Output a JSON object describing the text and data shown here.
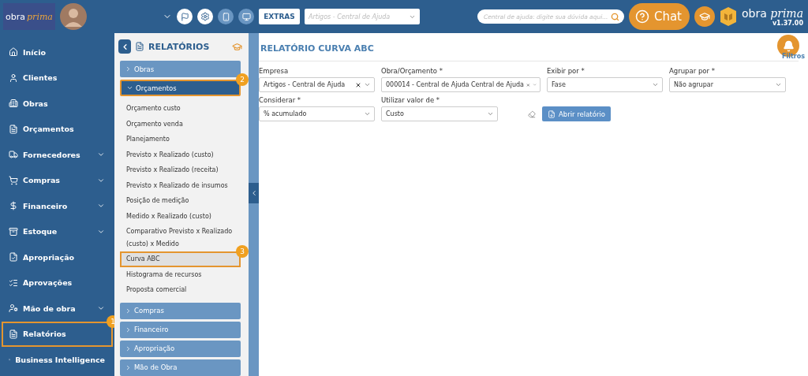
{
  "header": {
    "logo": {
      "word1": "obra",
      "word2": "prima"
    },
    "extras": "EXTRAS",
    "article_select": {
      "placeholder": "Artigos - Central de Ajuda"
    },
    "help_search": {
      "placeholder": "Central de ajuda: digite sua dúvida aqui..."
    },
    "chat": "Chat",
    "brand": {
      "word1": "obra",
      "word2": "prima"
    },
    "version": "v1.37.00"
  },
  "sidebar": {
    "items": [
      {
        "label": "Início",
        "expandable": false,
        "selected": false
      },
      {
        "label": "Clientes",
        "expandable": false,
        "selected": false
      },
      {
        "label": "Obras",
        "expandable": false,
        "selected": false
      },
      {
        "label": "Orçamentos",
        "expandable": false,
        "selected": false
      },
      {
        "label": "Fornecedores",
        "expandable": true,
        "selected": false
      },
      {
        "label": "Compras",
        "expandable": true,
        "selected": false
      },
      {
        "label": "Financeiro",
        "expandable": true,
        "selected": false
      },
      {
        "label": "Estoque",
        "expandable": true,
        "selected": false
      },
      {
        "label": "Apropriação",
        "expandable": false,
        "selected": false
      },
      {
        "label": "Aprovações",
        "expandable": false,
        "selected": false
      },
      {
        "label": "Mão de obra",
        "expandable": true,
        "selected": false
      },
      {
        "label": "Relatórios",
        "expandable": false,
        "selected": true,
        "badge": "1"
      },
      {
        "label": "Business Intelligence",
        "expandable": false,
        "selected": false
      }
    ]
  },
  "reports": {
    "title": "RELATÓRIOS",
    "groups": [
      {
        "label": "Obras",
        "expanded": false,
        "selected": false
      },
      {
        "label": "Orçamentos",
        "expanded": true,
        "selected": true,
        "badge": "2",
        "children": [
          {
            "label": "Orçamento custo",
            "selected": false
          },
          {
            "label": "Orçamento venda",
            "selected": false
          },
          {
            "label": "Planejamento",
            "selected": false
          },
          {
            "label": "Previsto x Realizado (custo)",
            "selected": false
          },
          {
            "label": "Previsto x Realizado (receita)",
            "selected": false
          },
          {
            "label": "Previsto x Realizado de insumos",
            "selected": false
          },
          {
            "label": "Posição de medição",
            "selected": false
          },
          {
            "label": "Medido x Realizado (custo)",
            "selected": false
          },
          {
            "label": "Comparativo Previsto x Realizado (custo) x Medido",
            "selected": false
          },
          {
            "label": "Curva ABC",
            "selected": true,
            "badge": "3"
          },
          {
            "label": "Histograma de recursos",
            "selected": false
          },
          {
            "label": "Proposta comercial",
            "selected": false
          }
        ]
      },
      {
        "label": "Compras",
        "expanded": false,
        "selected": false
      },
      {
        "label": "Financeiro",
        "expanded": false,
        "selected": false
      },
      {
        "label": "Apropriação",
        "expanded": false,
        "selected": false
      },
      {
        "label": "Mão de Obra",
        "expanded": false,
        "selected": false
      }
    ]
  },
  "main": {
    "title": "RELATÓRIO CURVA ABC",
    "filters": "Filtros",
    "rows": [
      [
        {
          "label": "Empresa",
          "value": "Artigos - Central de Ajuda",
          "clearable": true
        },
        {
          "label": "Obra/Orçamento *",
          "value": "000014 - Central de Ajuda Central de Ajuda",
          "clearable": true
        },
        {
          "label": "Exibir por *",
          "value": "Fase",
          "clearable": false
        },
        {
          "label": "Agrupar por *",
          "value": "Não agrupar",
          "clearable": false
        }
      ],
      [
        {
          "label": "Considerar *",
          "value": "% acumulado",
          "clearable": false
        },
        {
          "label": "Utilizar valor de *",
          "value": "Custo",
          "clearable": false
        }
      ]
    ],
    "open_button": "Abrir relatório"
  }
}
